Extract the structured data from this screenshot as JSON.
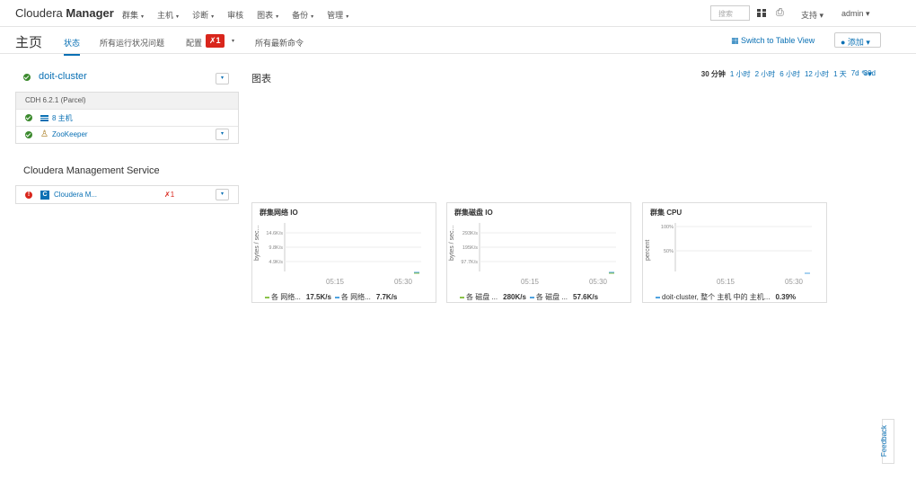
{
  "topnav": {
    "brand_plain": "Cloudera ",
    "brand_bold": "Manager",
    "items": [
      {
        "label": "群集",
        "caret": "▾"
      },
      {
        "label": "主机",
        "caret": "▾"
      },
      {
        "label": "诊断",
        "caret": "▾"
      },
      {
        "label": "审核",
        "caret": ""
      },
      {
        "label": "图表",
        "caret": "▾"
      },
      {
        "label": "备份",
        "caret": "▾"
      },
      {
        "label": "管理",
        "caret": "▾"
      }
    ],
    "search_placeholder": "搜索",
    "support_label": "支持 ▾",
    "admin_label": "admin ▾"
  },
  "subbar": {
    "title": "主页",
    "tabs": {
      "status": "状态",
      "health_issues": "所有运行状况问题",
      "config": "配置",
      "commands": "所有最新命令"
    },
    "config_badge": "✗1",
    "config_caret": "▾",
    "switch_table": "▦ Switch to Table View",
    "add_label": "● 添加 ▾"
  },
  "cluster": {
    "name": "doit-cluster",
    "version": "CDH 6.2.1 (Parcel)",
    "hosts_label": "8 主机",
    "zookeeper_label": "ZooKeeper"
  },
  "cms": {
    "title": "Cloudera Management Service",
    "link": "Cloudera M...",
    "alerts": "✗1"
  },
  "charts_panel": {
    "title": "图表",
    "ranges": [
      "30 分钟",
      "1 小时",
      "2 小时",
      "6 小时",
      "12 小时",
      "1 天",
      "7d",
      "30d"
    ],
    "selected_range": "30 分钟",
    "edit_icon": "✎▾"
  },
  "chart_data": [
    {
      "type": "line",
      "title": "群集网络 IO",
      "ylabel": "bytes / sec...",
      "y_ticks": [
        "14.6K/s",
        "9.8K/s",
        "4.9K/s"
      ],
      "x_ticks": [
        "05:15",
        "05:30"
      ],
      "series": [
        {
          "name": "各 网络...",
          "value_label": "17.5K/s",
          "color": "#8bc34a"
        },
        {
          "name": "各 网络...",
          "value_label": "7.7K/s",
          "color": "#4fa3e0"
        }
      ]
    },
    {
      "type": "line",
      "title": "群集磁盘 IO",
      "ylabel": "bytes / sec...",
      "y_ticks": [
        "293K/s",
        "195K/s",
        "97.7K/s"
      ],
      "x_ticks": [
        "05:15",
        "05:30"
      ],
      "series": [
        {
          "name": "各 磁盘 ...",
          "value_label": "280K/s",
          "color": "#8bc34a"
        },
        {
          "name": "各 磁盘 ...",
          "value_label": "57.6K/s",
          "color": "#4fa3e0"
        }
      ]
    },
    {
      "type": "line",
      "title": "群集 CPU",
      "ylabel": "percent",
      "y_ticks": [
        "100%",
        "50%"
      ],
      "x_ticks": [
        "05:15",
        "05:30"
      ],
      "series": [
        {
          "name": "doit-cluster, 整个 主机 中的 主机...",
          "value_label": "0.39%",
          "color": "#4fa3e0"
        }
      ]
    }
  ],
  "feedback_label": "Feedback"
}
